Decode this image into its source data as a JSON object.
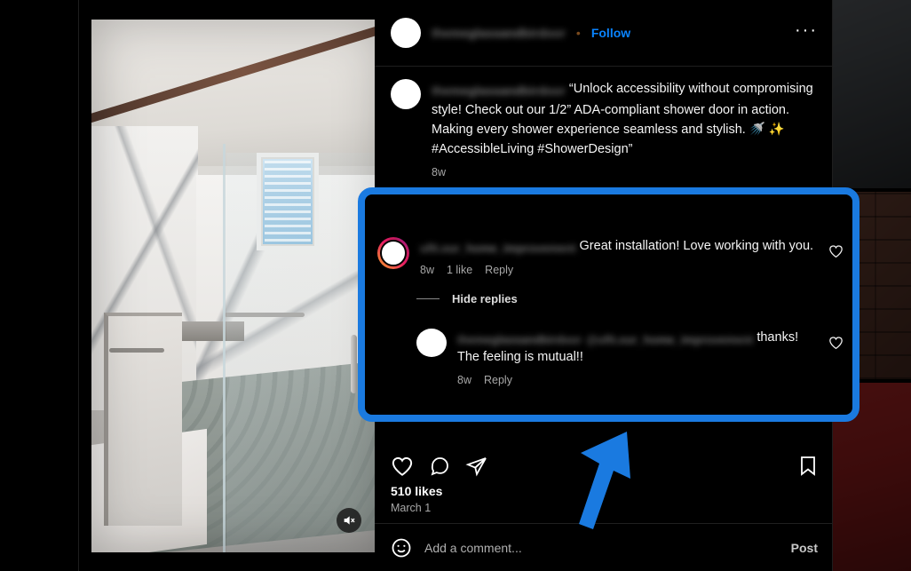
{
  "app": {
    "name": "instagram-post-modal",
    "accent_blue": "#0a84ff",
    "annotation_blue": "#1a7ae0"
  },
  "post_header": {
    "username_blurred": "themeglassandbirdoor",
    "separator": "•",
    "follow_label": "Follow",
    "more_options_label": "···"
  },
  "caption": {
    "username_blurred": "themeglassandbirdoor",
    "text": "“Unlock accessibility without compromising style! Check out our 1/2” ADA-compliant shower door in action. Making every shower experience seamless and stylish. 🚿 ✨ #AccessibleLiving #ShowerDesign”",
    "timestamp": "8w"
  },
  "highlighted_comment": {
    "username_blurred": "ufit.our_home_improvement",
    "text": "Great installation! Love working with you.",
    "timestamp": "8w",
    "likes": "1 like",
    "reply_label": "Reply",
    "hide_replies_label": "Hide replies",
    "reply": {
      "username_blurred": "themeglassandbirdoor",
      "mention_blurred": "@ufit.our_home_improvement",
      "text": "thanks! The feeling is mutual!!",
      "timestamp": "8w",
      "reply_label": "Reply"
    }
  },
  "actions": {
    "like_icon": "heart-icon",
    "comment_icon": "comment-bubble-icon",
    "share_icon": "share-paper-plane-icon",
    "save_icon": "bookmark-icon"
  },
  "stats": {
    "likes": "510 likes",
    "date": "March 1"
  },
  "add_comment": {
    "emoji_icon": "smiley-face-icon",
    "placeholder": "Add a comment...",
    "post_label": "Post"
  },
  "media": {
    "type": "video",
    "mute_icon": "muted-speaker-icon",
    "description": "marble-tiled walk-in shower with glass door"
  },
  "annotations": {
    "highlight_box_label": "comment-thread-highlight",
    "arrow_label": "blue-pointer-arrow"
  }
}
